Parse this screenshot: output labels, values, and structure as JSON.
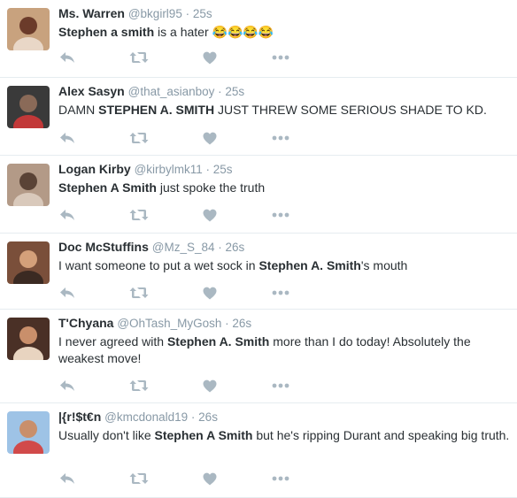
{
  "colors": {
    "icon": "#aab8c2",
    "meta": "#8899a6",
    "text": "#292f33",
    "divider": "#e6ecf0"
  },
  "tweets": [
    {
      "name": "Ms. Warren",
      "handle": "@bkgirl95",
      "time": "25s",
      "segments": [
        {
          "t": "Stephen a smith",
          "b": true
        },
        {
          "t": " is a hater ",
          "b": false
        },
        {
          "t": "😂😂😂😂",
          "b": false
        }
      ]
    },
    {
      "name": "Alex Sasyn",
      "handle": "@that_asianboy",
      "time": "25s",
      "segments": [
        {
          "t": "DAMN ",
          "b": false
        },
        {
          "t": "STEPHEN A. SMITH",
          "b": true
        },
        {
          "t": " JUST THREW SOME SERIOUS SHADE TO KD.",
          "b": false
        }
      ]
    },
    {
      "name": "Logan Kirby",
      "handle": "@kirbylmk11",
      "time": "25s",
      "segments": [
        {
          "t": "Stephen A Smith",
          "b": true
        },
        {
          "t": " just spoke the truth",
          "b": false
        }
      ]
    },
    {
      "name": "Doc McStuffins",
      "handle": "@Mz_S_84",
      "time": "26s",
      "segments": [
        {
          "t": "I want someone to put a wet sock in ",
          "b": false
        },
        {
          "t": "Stephen A. Smith",
          "b": true
        },
        {
          "t": "'s mouth",
          "b": false
        }
      ]
    },
    {
      "name": "T'Chyana",
      "handle": "@OhTash_MyGosh",
      "time": "26s",
      "segments": [
        {
          "t": "I never agreed with ",
          "b": false
        },
        {
          "t": "Stephen A. Smith",
          "b": true
        },
        {
          "t": " more than I do today! Absolutely the weakest move!",
          "b": false
        }
      ]
    },
    {
      "name": "|{r!$t€n",
      "handle": "@kmcdonald19",
      "time": "26s",
      "segments": [
        {
          "t": "Usually don't like ",
          "b": false
        },
        {
          "t": "Stephen A Smith",
          "b": true
        },
        {
          "t": " but he's ripping Durant and speaking big truth.",
          "b": false
        }
      ]
    }
  ],
  "separator": " · "
}
